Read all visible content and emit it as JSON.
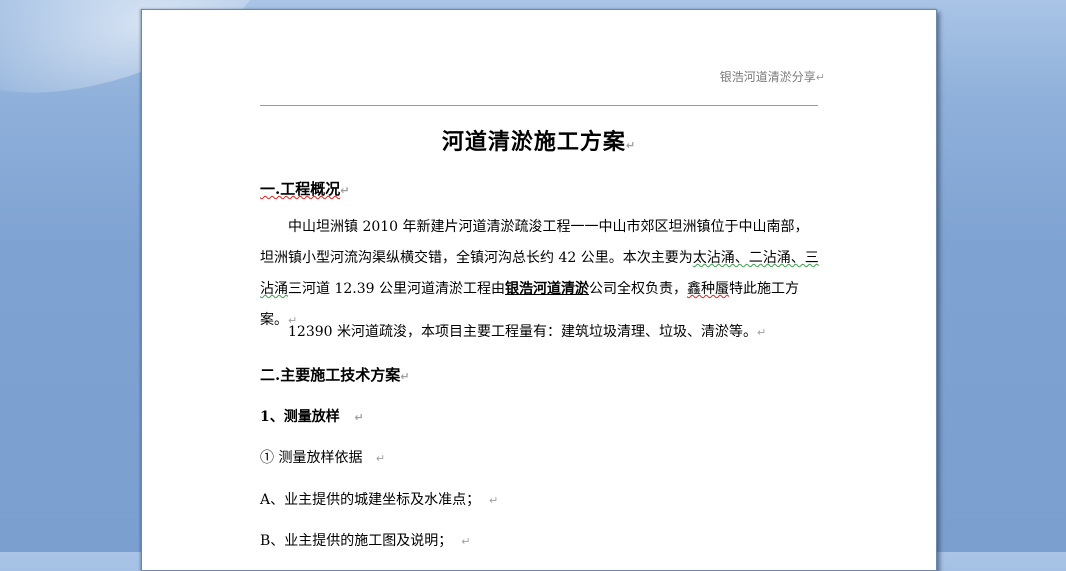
{
  "header": {
    "text": "银浩河道清淤分享"
  },
  "title": "河道清淤施工方案",
  "section1": {
    "heading": "一.工程概况",
    "p1": {
      "a": "中山坦洲镇 2010 年新建片河道清淤疏浚工程一一中山市郊区坦洲镇位于中山南部，坦洲镇小型河流沟渠纵横交错，全镇河沟总长约 42 公里。本次主要为",
      "b": "太沾涌、二沾涌、三沾涌",
      "c": "三河道 12.39 公里河道清淤工程由",
      "d": "银浩河道清淤",
      "e": "公司全权负责，",
      "f": "鑫种蜃",
      "g": "特此施工方案。"
    },
    "p2": "12390 米河道疏浚，本项目主要工程量有：建筑垃圾清理、垃圾、清淤等。"
  },
  "section2": {
    "heading": "二.主要施工技术方案",
    "sub1": "1、测量放样",
    "item1": "① 测量放样依据",
    "itemA": "A、业主提供的城建坐标及水准点；",
    "itemB": "B、业主提供的施工图及说明；"
  },
  "marks": {
    "para": "↵"
  }
}
